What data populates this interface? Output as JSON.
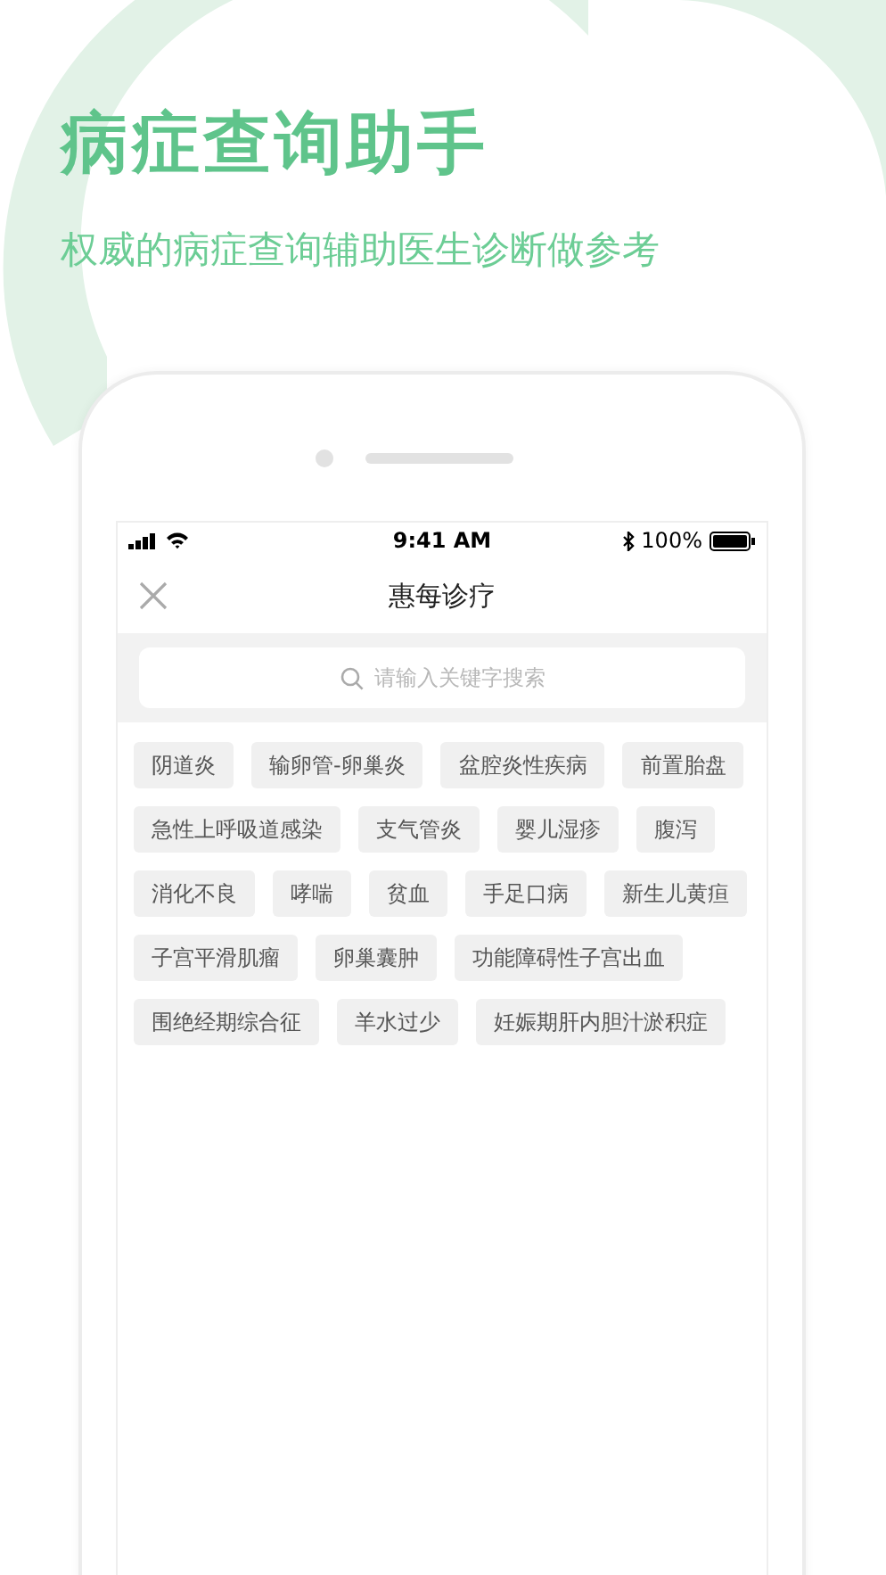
{
  "headline": "病症查询助手",
  "subtitle": "权威的病症查询辅助医生诊断做参考",
  "status_bar": {
    "time": "9:41 AM",
    "battery": "100%"
  },
  "nav": {
    "title": "惠每诊疗"
  },
  "search": {
    "placeholder": "请输入关键字搜索"
  },
  "tag_rows": [
    [
      "阴道炎",
      "输卵管-卵巢炎",
      "盆腔炎性疾病",
      "前置胎盘"
    ],
    [
      "急性上呼吸道感染",
      "支气管炎",
      "婴儿湿疹",
      "腹泻"
    ],
    [
      "消化不良",
      "哮喘",
      "贫血",
      "手足口病",
      "新生儿黄疸"
    ],
    [
      "子宫平滑肌瘤",
      "卵巢囊肿",
      "功能障碍性子宫出血"
    ],
    [
      "围绝经期综合征",
      "羊水过少",
      "妊娠期肝内胆汁淤积症"
    ]
  ]
}
